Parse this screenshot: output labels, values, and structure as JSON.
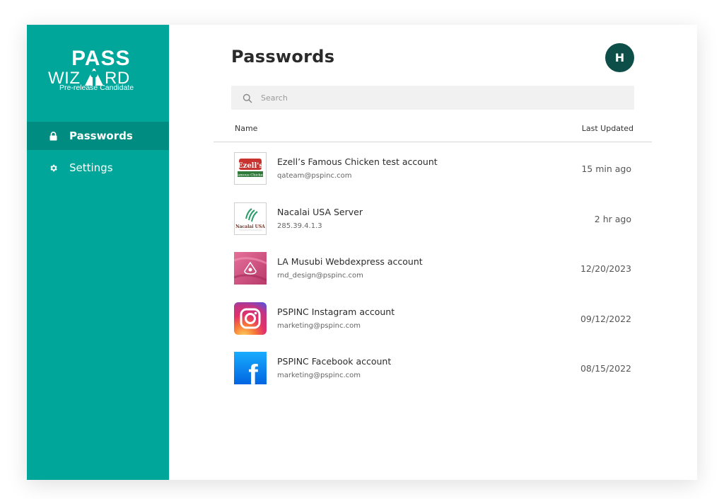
{
  "app": {
    "logo_line1": "PASS",
    "logo_line2_left": "WIZ",
    "logo_line2_right": "RD",
    "tagline": "Pre-release Candidate"
  },
  "sidebar": {
    "items": [
      {
        "label": "Passwords",
        "icon": "lock-icon",
        "active": true
      },
      {
        "label": "Settings",
        "icon": "gear-icon",
        "active": false
      }
    ]
  },
  "header": {
    "title": "Passwords",
    "avatar_initial": "H"
  },
  "search": {
    "placeholder": "Search",
    "value": ""
  },
  "table": {
    "columns": {
      "name": "Name",
      "updated": "Last Updated"
    },
    "rows": [
      {
        "title": "Ezell’s Famous Chicken test account",
        "subtitle": "qateam@pspinc.com",
        "updated": "15 min ago",
        "logo": "ezells-logo",
        "logo_text": "Ezell's",
        "logo_caption": "Famous Chicken"
      },
      {
        "title": "Nacalai USA Server",
        "subtitle": "285.39.4.1.3",
        "updated": "2 hr ago",
        "logo": "nacalai-logo",
        "logo_text": "Nacalai USA"
      },
      {
        "title": "LA Musubi Webdexpress account",
        "subtitle": "rnd_design@pspinc.com",
        "updated": "12/20/2023",
        "logo": "la-musubi-logo"
      },
      {
        "title": "PSPINC Instagram account",
        "subtitle": "marketing@pspinc.com",
        "updated": "09/12/2022",
        "logo": "instagram-logo"
      },
      {
        "title": "PSPINC Facebook account",
        "subtitle": "marketing@pspinc.com",
        "updated": "08/15/2022",
        "logo": "facebook-logo",
        "logo_text": "f"
      }
    ]
  },
  "colors": {
    "sidebar": "#00a699",
    "sidebar_active": "#008c80",
    "avatar": "#0d4f48",
    "search_bg": "#f1f1f1"
  }
}
